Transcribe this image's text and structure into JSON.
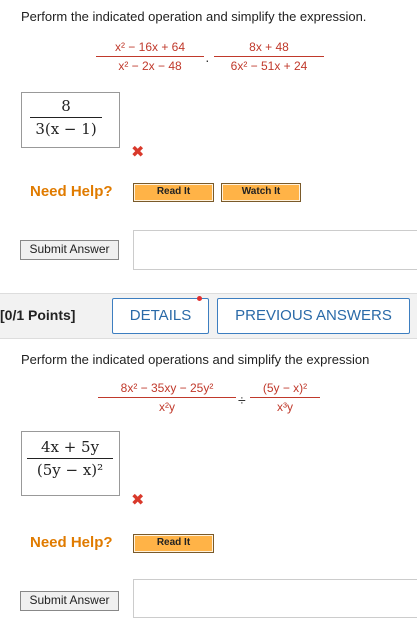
{
  "q1": {
    "prompt": "Perform the indicated operation and simplify the expression.",
    "frac1_num": "x² − 16x + 64",
    "frac1_den": "x² − 2x − 48",
    "operator": "·",
    "frac2_num": "8x + 48",
    "frac2_den": "6x² − 51x + 24",
    "answer_num": "8",
    "answer_den": "3(x − 1)",
    "incorrect_mark": "✖",
    "need_help": "Need Help?",
    "read_it": "Read It",
    "watch_it": "Watch It",
    "submit": "Submit Answer"
  },
  "q2_header": {
    "points": "[0/1 Points]",
    "details": "DETAILS",
    "previous_answers": "PREVIOUS ANSWERS"
  },
  "q2": {
    "prompt": "Perform the indicated operations and simplify the expression",
    "frac1_num": "8x² − 35xy − 25y²",
    "frac1_den": "x²y",
    "operator": "÷",
    "frac2_num": "(5y − x)²",
    "frac2_den": "x³y",
    "answer_num": "4x + 5y",
    "answer_den": "(5y − x)²",
    "incorrect_mark": "✖",
    "need_help": "Need Help?",
    "read_it": "Read It",
    "submit": "Submit Answer"
  },
  "colors": {
    "expression": "#c0392b",
    "need_help": "#e07b00",
    "incorrect": "#d9392b",
    "tab_accent": "#2a6aa8"
  }
}
